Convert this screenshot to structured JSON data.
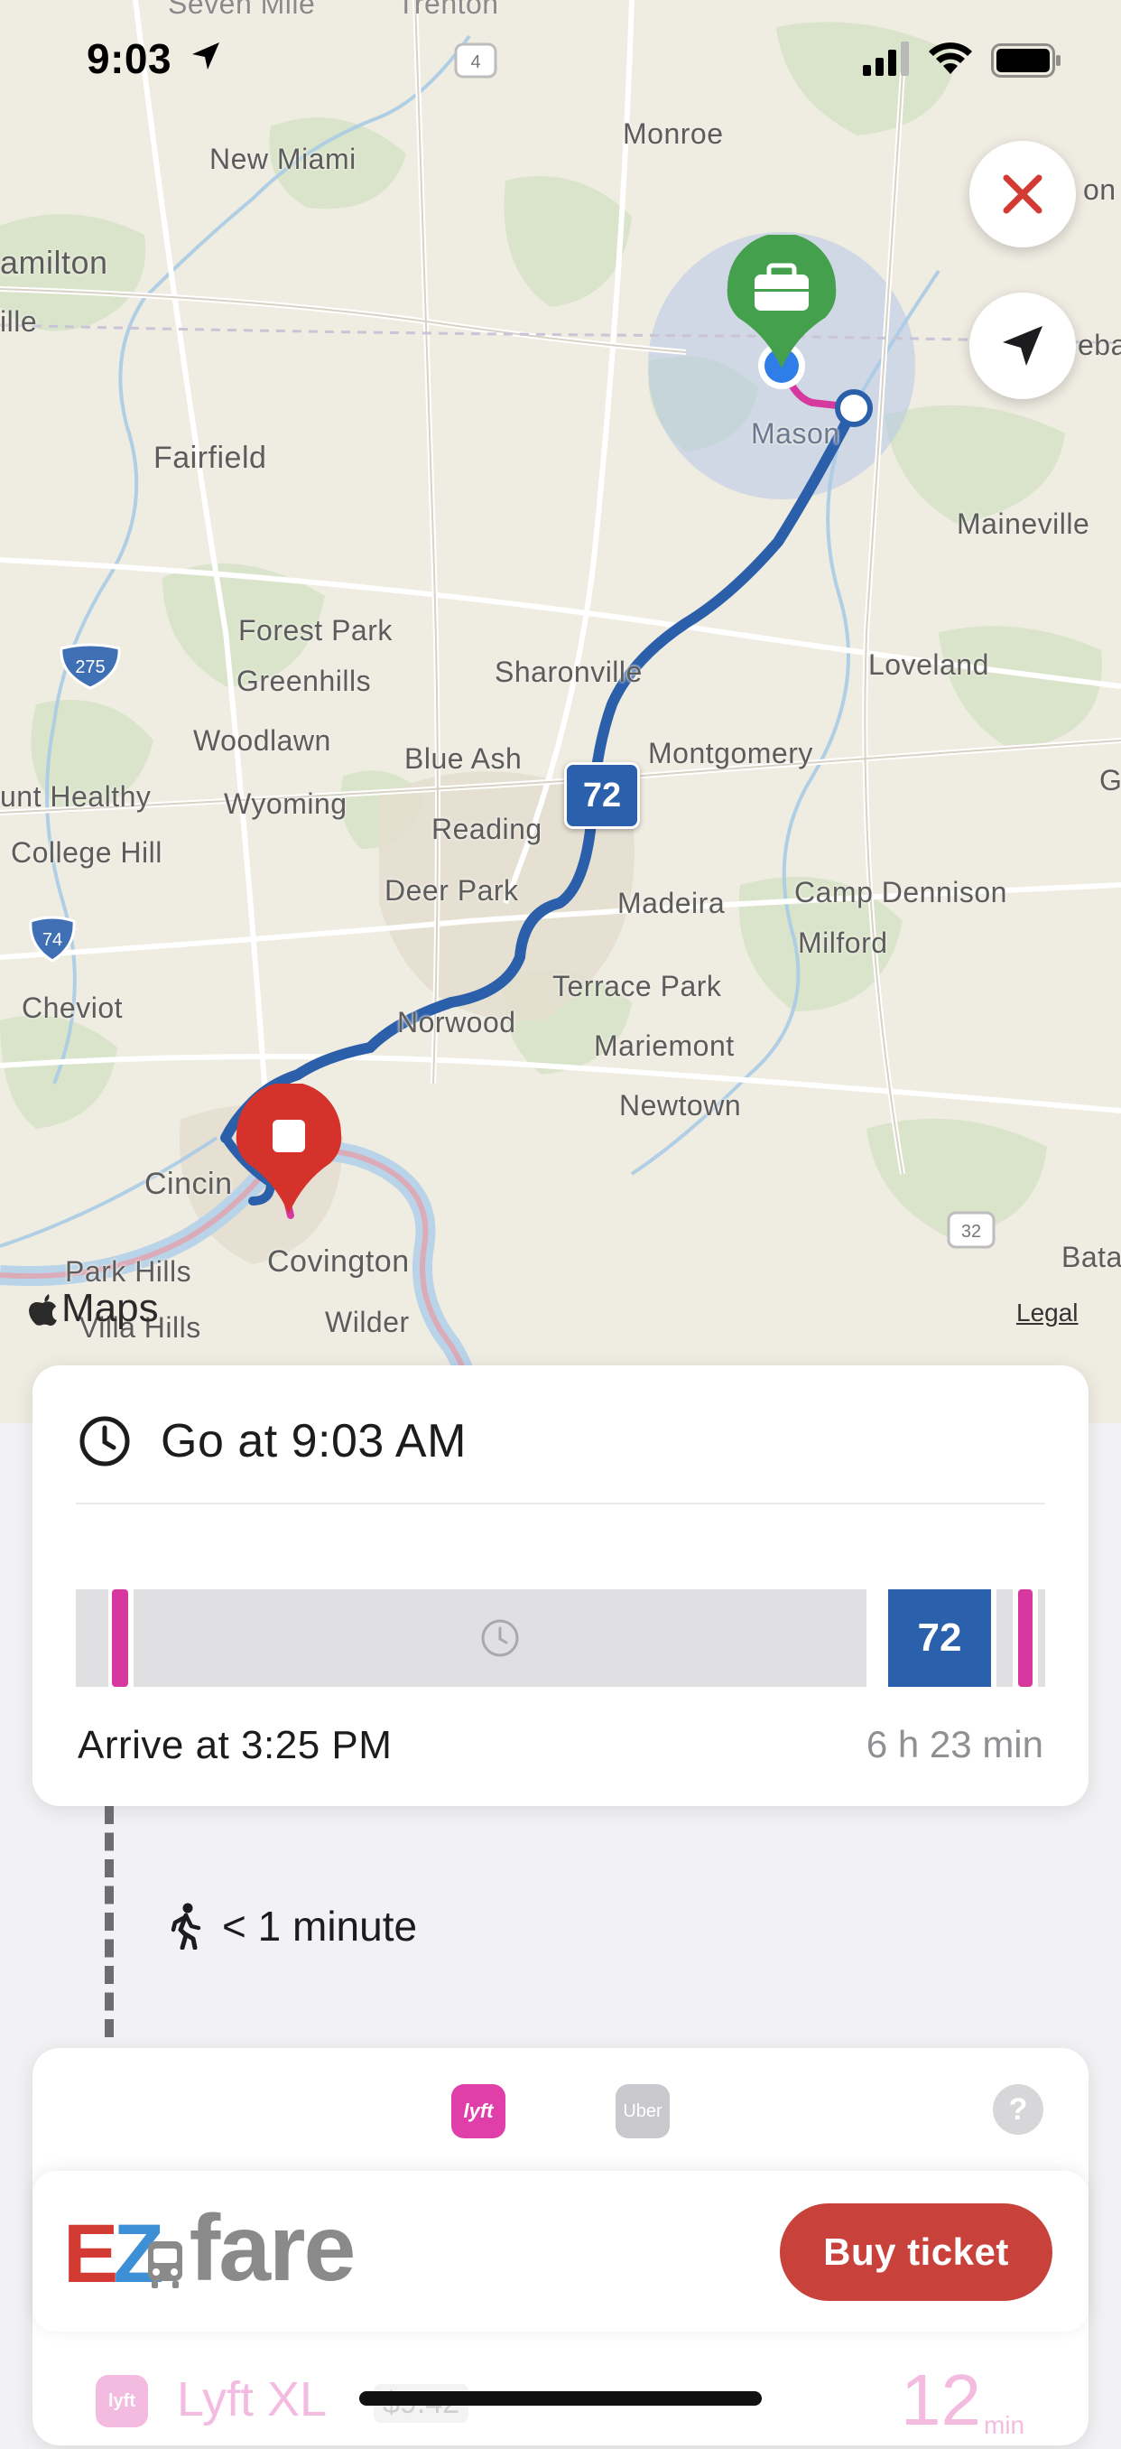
{
  "status_bar": {
    "time": "9:03"
  },
  "map": {
    "places": [
      {
        "id": "seven-mile",
        "name": "Seven Mile",
        "dim": true
      },
      {
        "id": "trenton",
        "name": "Trenton",
        "dim": true
      },
      {
        "id": "monroe",
        "name": "Monroe"
      },
      {
        "id": "new-miami",
        "name": "New Miami"
      },
      {
        "id": "hamilton",
        "name": "amilton"
      },
      {
        "id": "ille",
        "name": "ille"
      },
      {
        "id": "fairfield",
        "name": "Fairfield"
      },
      {
        "id": "mason",
        "name": "Mason"
      },
      {
        "id": "maineville",
        "name": "Maineville"
      },
      {
        "id": "forest-park",
        "name": "Forest Park"
      },
      {
        "id": "greenhills",
        "name": "Greenhills"
      },
      {
        "id": "sharonville",
        "name": "Sharonville"
      },
      {
        "id": "loveland",
        "name": "Loveland"
      },
      {
        "id": "woodlawn",
        "name": "Woodlawn"
      },
      {
        "id": "blue-ash",
        "name": "Blue Ash"
      },
      {
        "id": "montgomery",
        "name": "Montgomery"
      },
      {
        "id": "mount-healthy",
        "name": "unt Healthy"
      },
      {
        "id": "wyoming",
        "name": "Wyoming"
      },
      {
        "id": "reading",
        "name": "Reading"
      },
      {
        "id": "college-hill",
        "name": "College Hill"
      },
      {
        "id": "deer-park",
        "name": "Deer Park"
      },
      {
        "id": "madeira",
        "name": "Madeira"
      },
      {
        "id": "camp-dennison",
        "name": "Camp Dennison"
      },
      {
        "id": "milford",
        "name": "Milford"
      },
      {
        "id": "cheviot",
        "name": "Cheviot"
      },
      {
        "id": "terrace-park",
        "name": "Terrace Park"
      },
      {
        "id": "norwood",
        "name": "Norwood"
      },
      {
        "id": "mariemont",
        "name": "Mariemont"
      },
      {
        "id": "newtown",
        "name": "Newtown"
      },
      {
        "id": "cincinnati",
        "name": "Cincin"
      },
      {
        "id": "park-hills",
        "name": "Park Hills"
      },
      {
        "id": "covington",
        "name": "Covington"
      },
      {
        "id": "villa-hills",
        "name": "Villa Hills"
      },
      {
        "id": "wilder",
        "name": "Wilder"
      },
      {
        "id": "batavia",
        "name": "Bata"
      },
      {
        "id": "edge-on",
        "name": "on"
      },
      {
        "id": "edge-eba",
        "name": "eba"
      },
      {
        "id": "edge-g",
        "name": "G"
      }
    ],
    "shields": {
      "i275": "275",
      "i74": "74",
      "us4": "4",
      "us32": "32"
    },
    "route_number": "72",
    "maps_label": "Maps",
    "legal_label": "Legal",
    "close_icon": "close-x-icon",
    "locate_icon": "location-arrow-icon"
  },
  "trip": {
    "go_label": "Go at 9:03 AM",
    "route_number": "72",
    "arrive_label": "Arrive at 3:25 PM",
    "duration": "6 h 23 min",
    "colors": {
      "wait": "#e0e0e2",
      "walk": "#d6389f",
      "bus": "#2b60ad"
    }
  },
  "walk": {
    "label": "< 1 minute"
  },
  "rides": {
    "lyft_label": "lyft",
    "uber_label": "Uber",
    "help_label": "?"
  },
  "ezfare": {
    "logo_e": "E",
    "logo_z": "Z",
    "logo_fare": "fare",
    "buy_label": "Buy ticket"
  },
  "ride_option": {
    "icon_label": "lyft",
    "name": "Lyft XL",
    "price": "$9.42",
    "eta": "12",
    "eta_unit": "min"
  }
}
